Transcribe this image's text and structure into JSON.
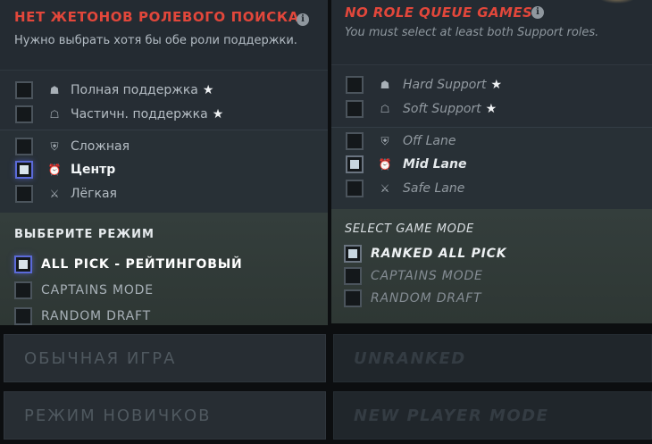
{
  "left": {
    "title": "НЕТ ЖЕТОНОВ РОЛЕВОГО ПОИСКА",
    "subtitle": "Нужно выбрать хотя бы обе роли поддержки.",
    "roles": [
      {
        "label": "Полная поддержка",
        "icon": "hard-support-icon",
        "star": "★",
        "checked": false
      },
      {
        "label": "Частичн. поддержка",
        "icon": "soft-support-icon",
        "star": "★",
        "checked": false
      }
    ],
    "lanes": [
      {
        "label": "Сложная",
        "icon": "offlane-icon",
        "checked": false
      },
      {
        "label": "Центр",
        "icon": "midlane-icon",
        "checked": true
      },
      {
        "label": "Лёгкая",
        "icon": "safelane-icon",
        "checked": false
      }
    ],
    "mode_title": "ВЫБЕРИТЕ РЕЖИМ",
    "modes": [
      {
        "label": "ALL PICK - РЕЙТИНГОВЫЙ",
        "checked": true
      },
      {
        "label": "CAPTAINS MODE",
        "checked": false
      },
      {
        "label": "RANDOM DRAFT",
        "checked": false
      }
    ],
    "buttons": {
      "normal": "ОБЫЧНАЯ ИГРА",
      "new_player": "РЕЖИМ НОВИЧКОВ"
    }
  },
  "right": {
    "title": "NO ROLE QUEUE GAMES",
    "subtitle": "You must select at least both Support roles.",
    "roles": [
      {
        "label": "Hard Support",
        "icon": "hard-support-icon",
        "star": "★",
        "checked": false
      },
      {
        "label": "Soft Support",
        "icon": "soft-support-icon",
        "star": "★",
        "checked": false
      }
    ],
    "lanes": [
      {
        "label": "Off Lane",
        "icon": "offlane-icon",
        "checked": false
      },
      {
        "label": "Mid Lane",
        "icon": "midlane-icon",
        "checked": true
      },
      {
        "label": "Safe Lane",
        "icon": "safelane-icon",
        "checked": false
      }
    ],
    "mode_title": "SELECT GAME MODE",
    "modes": [
      {
        "label": "RANKED ALL PICK",
        "checked": true
      },
      {
        "label": "CAPTAINS MODE",
        "checked": false
      },
      {
        "label": "RANDOM DRAFT",
        "checked": false
      }
    ],
    "buttons": {
      "normal": "UNRANKED",
      "new_player": "NEW PLAYER MODE"
    }
  },
  "colors": {
    "warning_title": "#e2473b",
    "selected_checkbox_border": "#5b6ad8"
  }
}
